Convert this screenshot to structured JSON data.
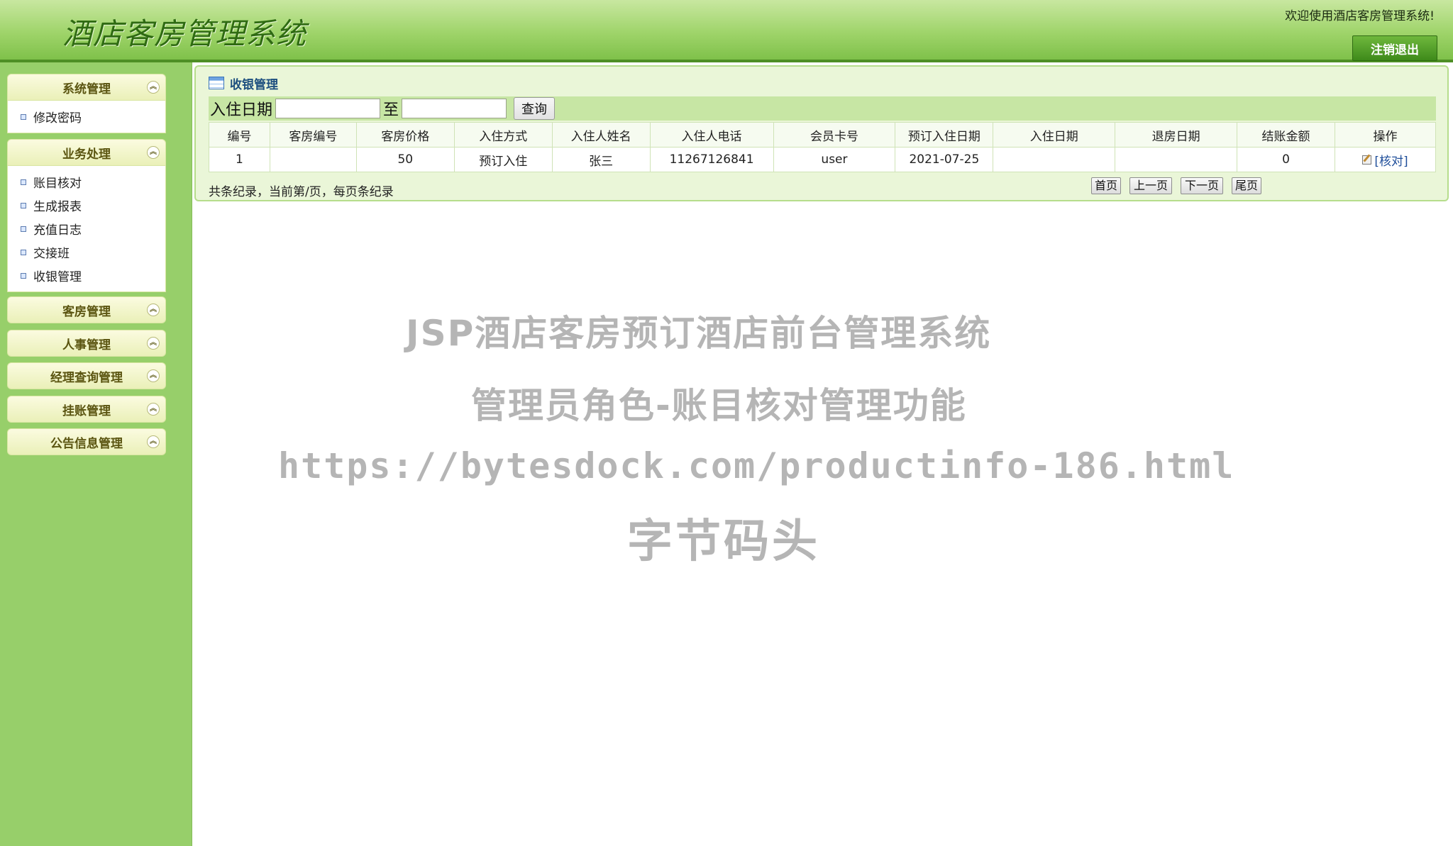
{
  "header": {
    "logo": "酒店客房管理系统",
    "welcome": "欢迎使用酒店客房管理系统!",
    "logout_label": "注销退出"
  },
  "sidebar": {
    "groups": [
      {
        "title": "系统管理",
        "items": [
          "修改密码"
        ]
      },
      {
        "title": "业务处理",
        "items": [
          "账目核对",
          "生成报表",
          "充值日志",
          "交接班",
          "收银管理"
        ]
      },
      {
        "title": "客房管理",
        "items": []
      },
      {
        "title": "人事管理",
        "items": []
      },
      {
        "title": "经理查询管理",
        "items": []
      },
      {
        "title": "挂账管理",
        "items": []
      },
      {
        "title": "公告信息管理",
        "items": []
      }
    ]
  },
  "main": {
    "panel_title": "收银管理",
    "search": {
      "label": "入住日期",
      "separator": "至",
      "button": "查询"
    },
    "table": {
      "headers": [
        "编号",
        "客房编号",
        "客房价格",
        "入住方式",
        "入住人姓名",
        "入住人电话",
        "会员卡号",
        "预订入住日期",
        "入住日期",
        "退房日期",
        "结账金额",
        "操作"
      ],
      "rows": [
        [
          "1",
          "",
          "50",
          "预订入住",
          "张三",
          "11267126841",
          "user",
          "2021-07-25",
          "",
          "",
          "0"
        ]
      ],
      "action_label": "[核对]"
    },
    "footer_text": "共条纪录，当前第/页，每页条纪录",
    "pager": [
      "首页",
      "上一页",
      "下一页",
      "尾页"
    ]
  },
  "watermark": {
    "line1": "JSP酒店客房预订酒店前台管理系统",
    "line2": "管理员角色-账目核对管理功能",
    "line3": "https://bytesdock.com/productinfo-186.html",
    "line4": "字节码头"
  }
}
